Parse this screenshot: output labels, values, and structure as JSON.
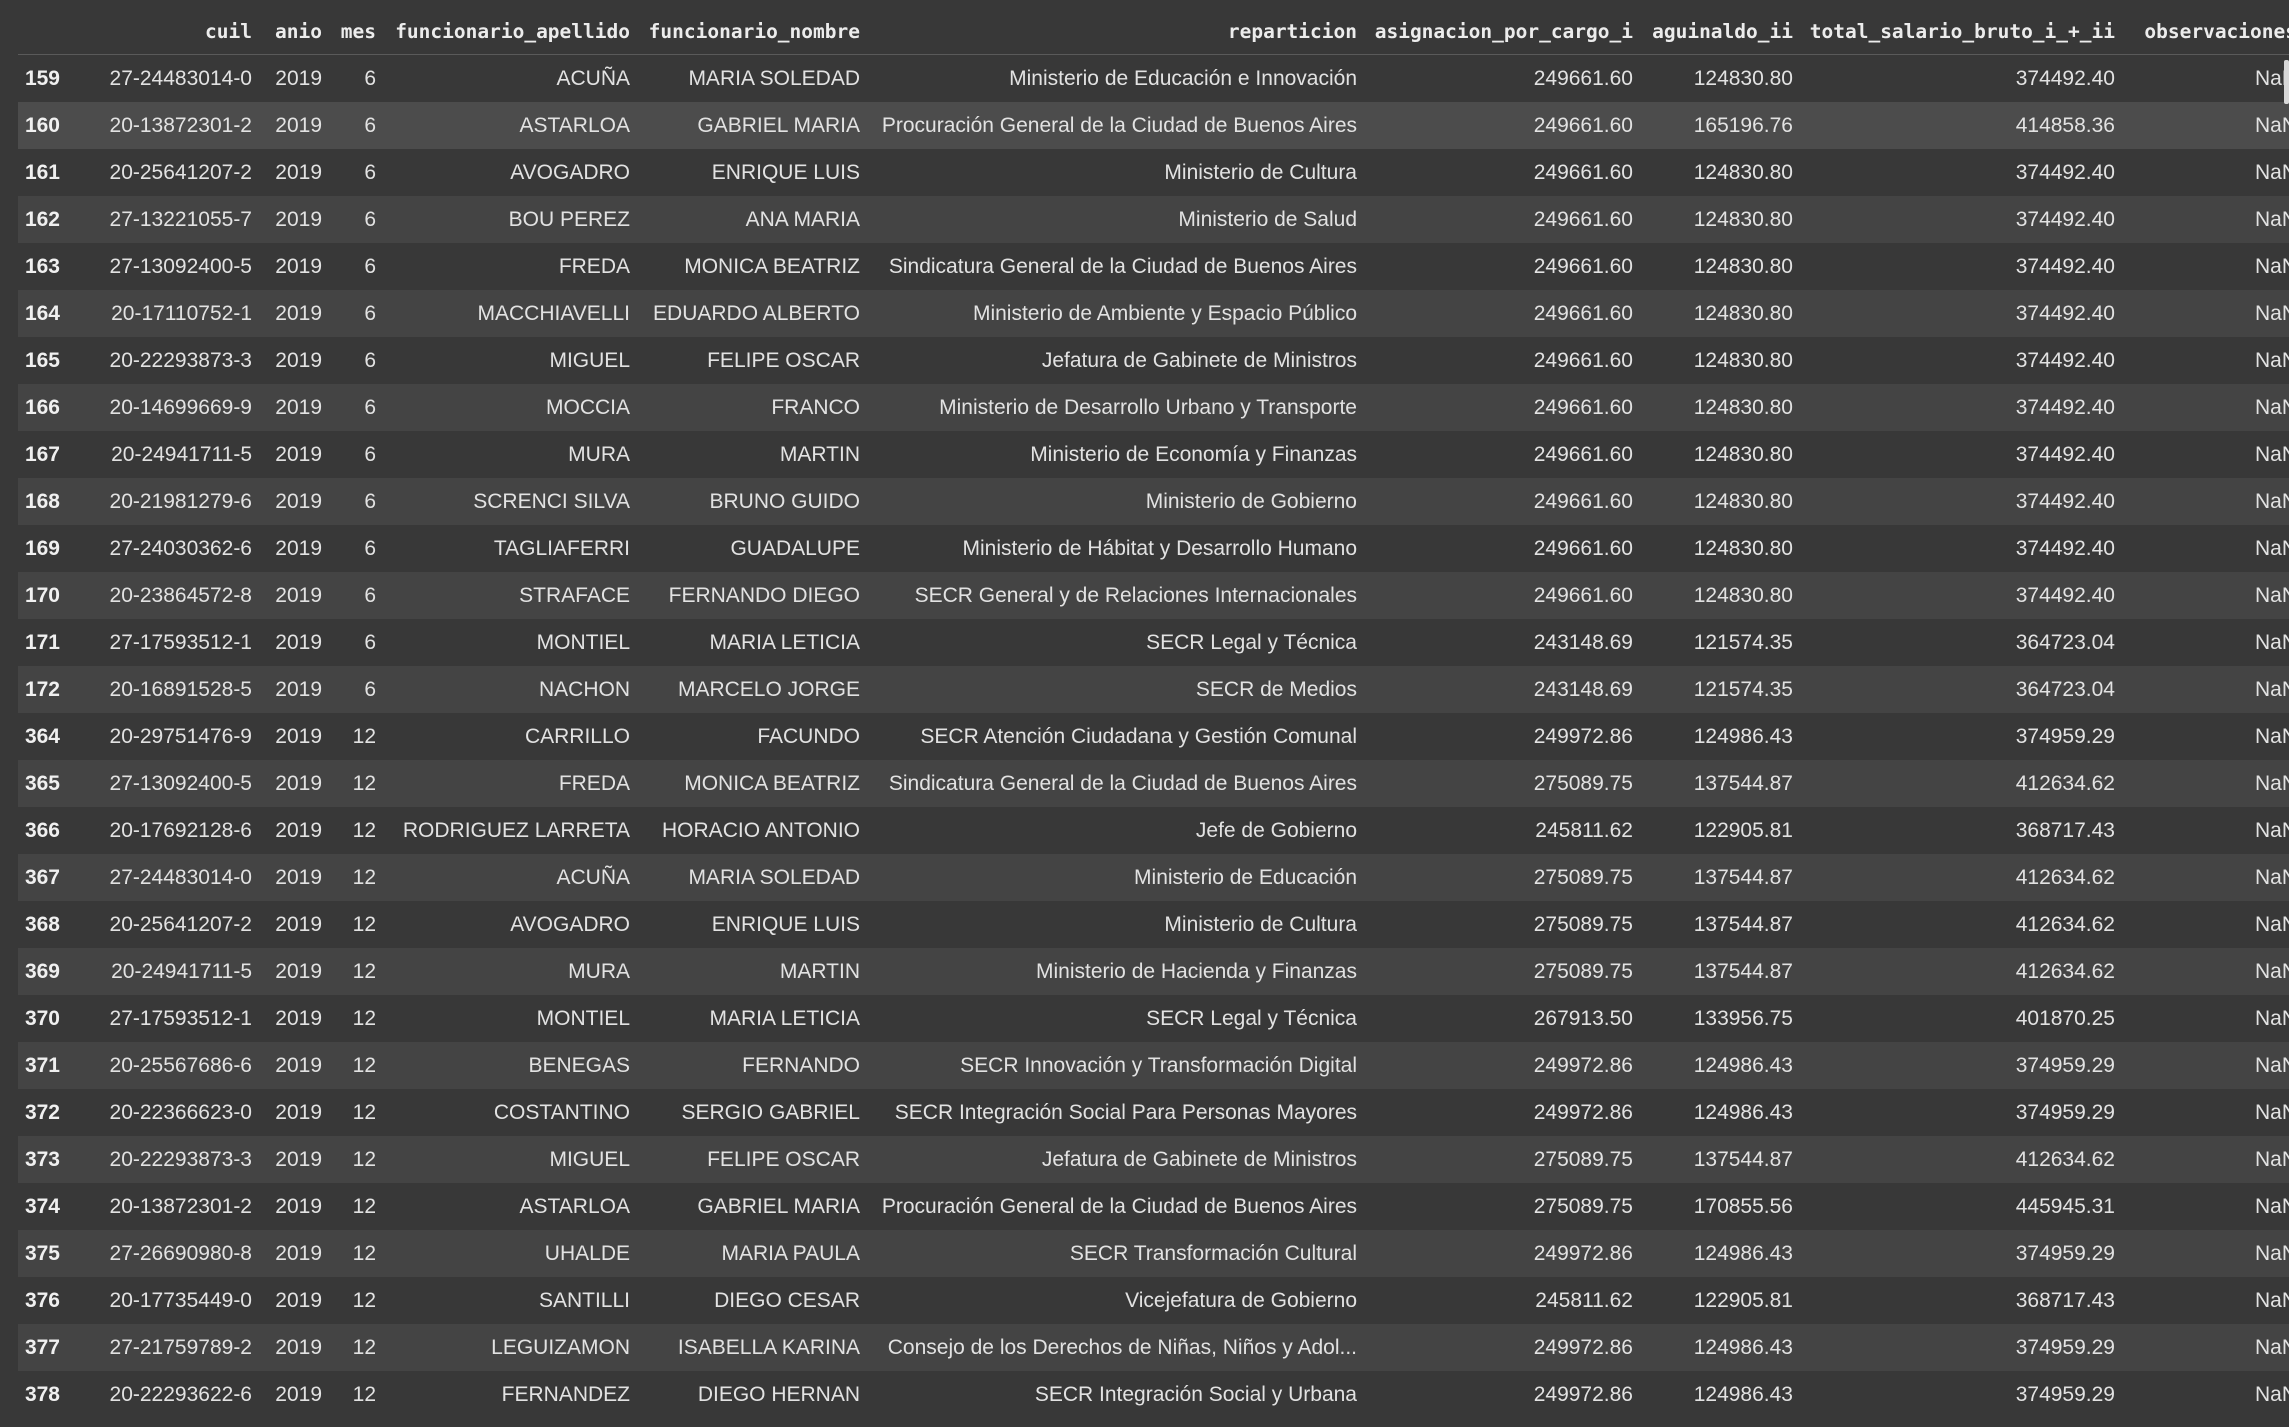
{
  "table": {
    "columns": [
      "",
      "cuil",
      "anio",
      "mes",
      "funcionario_apellido",
      "funcionario_nombre",
      "reparticion",
      "asignacion_por_cargo_i",
      "aguinaldo_ii",
      "total_salario_bruto_i_+_ii",
      "observaciones"
    ],
    "rows": [
      [
        "159",
        "27-24483014-0",
        "2019",
        "6",
        "ACUÑA",
        "MARIA SOLEDAD",
        "Ministerio de Educación e Innovación",
        "249661.60",
        "124830.80",
        "374492.40",
        "NaN"
      ],
      [
        "160",
        "20-13872301-2",
        "2019",
        "6",
        "ASTARLOA",
        "GABRIEL MARIA",
        "Procuración General de la Ciudad de Buenos Aires",
        "249661.60",
        "165196.76",
        "414858.36",
        "NaN"
      ],
      [
        "161",
        "20-25641207-2",
        "2019",
        "6",
        "AVOGADRO",
        "ENRIQUE LUIS",
        "Ministerio de Cultura",
        "249661.60",
        "124830.80",
        "374492.40",
        "NaN"
      ],
      [
        "162",
        "27-13221055-7",
        "2019",
        "6",
        "BOU PEREZ",
        "ANA MARIA",
        "Ministerio de Salud",
        "249661.60",
        "124830.80",
        "374492.40",
        "NaN"
      ],
      [
        "163",
        "27-13092400-5",
        "2019",
        "6",
        "FREDA",
        "MONICA BEATRIZ",
        "Sindicatura General de la Ciudad de Buenos Aires",
        "249661.60",
        "124830.80",
        "374492.40",
        "NaN"
      ],
      [
        "164",
        "20-17110752-1",
        "2019",
        "6",
        "MACCHIAVELLI",
        "EDUARDO ALBERTO",
        "Ministerio de Ambiente y Espacio Público",
        "249661.60",
        "124830.80",
        "374492.40",
        "NaN"
      ],
      [
        "165",
        "20-22293873-3",
        "2019",
        "6",
        "MIGUEL",
        "FELIPE OSCAR",
        "Jefatura de Gabinete de Ministros",
        "249661.60",
        "124830.80",
        "374492.40",
        "NaN"
      ],
      [
        "166",
        "20-14699669-9",
        "2019",
        "6",
        "MOCCIA",
        "FRANCO",
        "Ministerio de Desarrollo Urbano y Transporte",
        "249661.60",
        "124830.80",
        "374492.40",
        "NaN"
      ],
      [
        "167",
        "20-24941711-5",
        "2019",
        "6",
        "MURA",
        "MARTIN",
        "Ministerio de Economía y Finanzas",
        "249661.60",
        "124830.80",
        "374492.40",
        "NaN"
      ],
      [
        "168",
        "20-21981279-6",
        "2019",
        "6",
        "SCRENCI SILVA",
        "BRUNO GUIDO",
        "Ministerio de Gobierno",
        "249661.60",
        "124830.80",
        "374492.40",
        "NaN"
      ],
      [
        "169",
        "27-24030362-6",
        "2019",
        "6",
        "TAGLIAFERRI",
        "GUADALUPE",
        "Ministerio de Hábitat y Desarrollo Humano",
        "249661.60",
        "124830.80",
        "374492.40",
        "NaN"
      ],
      [
        "170",
        "20-23864572-8",
        "2019",
        "6",
        "STRAFACE",
        "FERNANDO DIEGO",
        "SECR General y de Relaciones Internacionales",
        "249661.60",
        "124830.80",
        "374492.40",
        "NaN"
      ],
      [
        "171",
        "27-17593512-1",
        "2019",
        "6",
        "MONTIEL",
        "MARIA LETICIA",
        "SECR Legal y Técnica",
        "243148.69",
        "121574.35",
        "364723.04",
        "NaN"
      ],
      [
        "172",
        "20-16891528-5",
        "2019",
        "6",
        "NACHON",
        "MARCELO JORGE",
        "SECR de Medios",
        "243148.69",
        "121574.35",
        "364723.04",
        "NaN"
      ],
      [
        "364",
        "20-29751476-9",
        "2019",
        "12",
        "CARRILLO",
        "FACUNDO",
        "SECR Atención Ciudadana y Gestión Comunal",
        "249972.86",
        "124986.43",
        "374959.29",
        "NaN"
      ],
      [
        "365",
        "27-13092400-5",
        "2019",
        "12",
        "FREDA",
        "MONICA BEATRIZ",
        "Sindicatura General de la Ciudad de Buenos Aires",
        "275089.75",
        "137544.87",
        "412634.62",
        "NaN"
      ],
      [
        "366",
        "20-17692128-6",
        "2019",
        "12",
        "RODRIGUEZ LARRETA",
        "HORACIO ANTONIO",
        "Jefe de Gobierno",
        "245811.62",
        "122905.81",
        "368717.43",
        "NaN"
      ],
      [
        "367",
        "27-24483014-0",
        "2019",
        "12",
        "ACUÑA",
        "MARIA SOLEDAD",
        "Ministerio de Educación",
        "275089.75",
        "137544.87",
        "412634.62",
        "NaN"
      ],
      [
        "368",
        "20-25641207-2",
        "2019",
        "12",
        "AVOGADRO",
        "ENRIQUE LUIS",
        "Ministerio de Cultura",
        "275089.75",
        "137544.87",
        "412634.62",
        "NaN"
      ],
      [
        "369",
        "20-24941711-5",
        "2019",
        "12",
        "MURA",
        "MARTIN",
        "Ministerio de Hacienda y Finanzas",
        "275089.75",
        "137544.87",
        "412634.62",
        "NaN"
      ],
      [
        "370",
        "27-17593512-1",
        "2019",
        "12",
        "MONTIEL",
        "MARIA LETICIA",
        "SECR Legal y Técnica",
        "267913.50",
        "133956.75",
        "401870.25",
        "NaN"
      ],
      [
        "371",
        "20-25567686-6",
        "2019",
        "12",
        "BENEGAS",
        "FERNANDO",
        "SECR Innovación y Transformación Digital",
        "249972.86",
        "124986.43",
        "374959.29",
        "NaN"
      ],
      [
        "372",
        "20-22366623-0",
        "2019",
        "12",
        "COSTANTINO",
        "SERGIO GABRIEL",
        "SECR Integración Social Para Personas Mayores",
        "249972.86",
        "124986.43",
        "374959.29",
        "NaN"
      ],
      [
        "373",
        "20-22293873-3",
        "2019",
        "12",
        "MIGUEL",
        "FELIPE OSCAR",
        "Jefatura de Gabinete de Ministros",
        "275089.75",
        "137544.87",
        "412634.62",
        "NaN"
      ],
      [
        "374",
        "20-13872301-2",
        "2019",
        "12",
        "ASTARLOA",
        "GABRIEL MARIA",
        "Procuración General de la Ciudad de Buenos Aires",
        "275089.75",
        "170855.56",
        "445945.31",
        "NaN"
      ],
      [
        "375",
        "27-26690980-8",
        "2019",
        "12",
        "UHALDE",
        "MARIA PAULA",
        "SECR Transformación Cultural",
        "249972.86",
        "124986.43",
        "374959.29",
        "NaN"
      ],
      [
        "376",
        "20-17735449-0",
        "2019",
        "12",
        "SANTILLI",
        "DIEGO CESAR",
        "Vicejefatura de Gobierno",
        "245811.62",
        "122905.81",
        "368717.43",
        "NaN"
      ],
      [
        "377",
        "27-21759789-2",
        "2019",
        "12",
        "LEGUIZAMON",
        "ISABELLA KARINA",
        "Consejo de los Derechos de Niñas, Niños y Adol...",
        "249972.86",
        "124986.43",
        "374959.29",
        "NaN"
      ],
      [
        "378",
        "20-22293622-6",
        "2019",
        "12",
        "FERNANDEZ",
        "DIEGO HERNAN",
        "SECR Integración Social y Urbana",
        "249972.86",
        "124986.43",
        "374959.29",
        "NaN"
      ]
    ]
  }
}
